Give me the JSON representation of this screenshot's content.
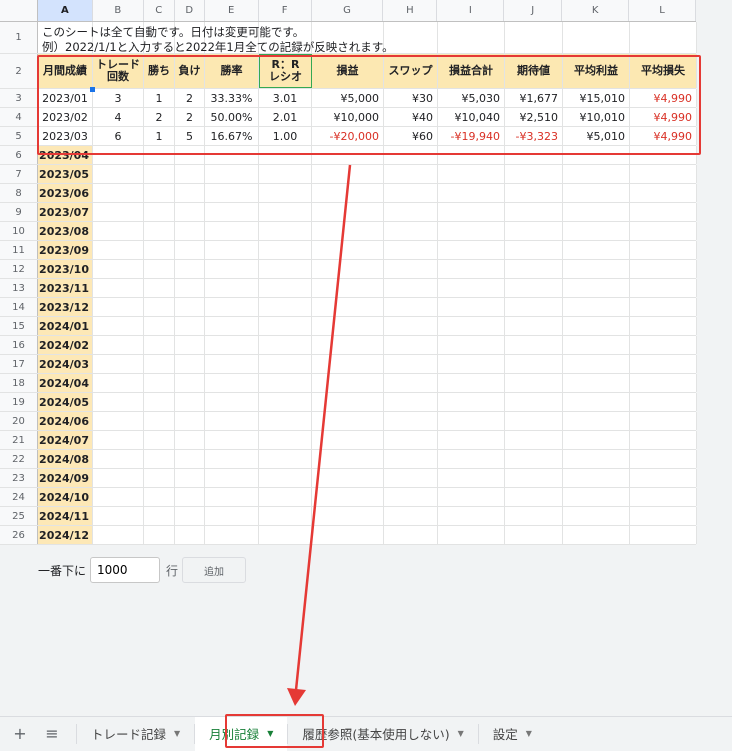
{
  "columns": [
    "A",
    "B",
    "C",
    "D",
    "E",
    "F",
    "G",
    "H",
    "I",
    "J",
    "K",
    "L"
  ],
  "selected_column": "A",
  "notes": {
    "line1": "このシートは全て自動です。日付は変更可能です。",
    "line2": "例）2022/1/1と入力すると2022年1月全ての記録が反映されます。"
  },
  "headers": {
    "a": "月間成績",
    "b1": "トレード",
    "b2": "回数",
    "c": "勝ち",
    "d": "負け",
    "e": "勝率",
    "f1": "R：R",
    "f2": "レシオ",
    "g": "損益",
    "h": "スワップ",
    "i": "損益合計",
    "j": "期待値",
    "k": "平均利益",
    "l": "平均損失"
  },
  "data_rows": [
    {
      "month": "2023/01",
      "trades": "3",
      "wins": "1",
      "losses": "2",
      "winrate": "33.33%",
      "rr": "3.01",
      "pnl": "¥5,000",
      "swap": "¥30",
      "total": "¥5,030",
      "expect": "¥1,677",
      "avg_win": "¥15,010",
      "avg_loss": "¥4,990"
    },
    {
      "month": "2023/02",
      "trades": "4",
      "wins": "2",
      "losses": "2",
      "winrate": "50.00%",
      "rr": "2.01",
      "pnl": "¥10,000",
      "swap": "¥40",
      "total": "¥10,040",
      "expect": "¥2,510",
      "avg_win": "¥10,010",
      "avg_loss": "¥4,990"
    },
    {
      "month": "2023/03",
      "trades": "6",
      "wins": "1",
      "losses": "5",
      "winrate": "16.67%",
      "rr": "1.00",
      "pnl": "-¥20,000",
      "swap": "¥60",
      "total": "-¥19,940",
      "expect": "-¥3,323",
      "avg_win": "¥5,010",
      "avg_loss": "¥4,990"
    }
  ],
  "months": [
    "2023/04",
    "2023/05",
    "2023/06",
    "2023/07",
    "2023/08",
    "2023/09",
    "2023/10",
    "2023/11",
    "2023/12",
    "2024/01",
    "2024/02",
    "2024/03",
    "2024/04",
    "2024/05",
    "2024/06",
    "2024/07",
    "2024/08",
    "2024/09",
    "2024/10",
    "2024/11",
    "2024/12"
  ],
  "add_rows": {
    "label_before": "一番下に",
    "value": "1000",
    "label_after": "行",
    "button": "追加"
  },
  "tabs": [
    {
      "label": "トレード記録",
      "active": false
    },
    {
      "label": "月別記録",
      "active": true
    },
    {
      "label": "履歴参照(基本使用しない)",
      "active": false
    },
    {
      "label": "設定",
      "active": false
    }
  ],
  "icons": {
    "add_sheet": "plus-icon",
    "all_sheets": "hamburger-icon",
    "dropdown": "caret-down-icon"
  },
  "colors": {
    "header_fill": "#fce8b2",
    "month_fill": "#fde8b6",
    "negative": "#d93025",
    "annotation": "#e53935",
    "active_tab": "#188038"
  }
}
